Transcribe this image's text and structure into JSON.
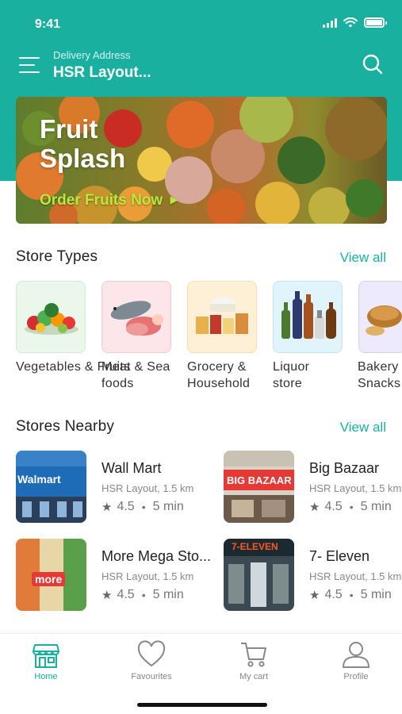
{
  "status_bar": {
    "time": "9:41"
  },
  "header": {
    "address_label": "Delivery Address",
    "address_value": "HSR Layout..."
  },
  "banner": {
    "title": "Fruit Splash",
    "cta": "Order Fruits Now"
  },
  "store_types": {
    "title": "Store Types",
    "view_all": "View all",
    "items": [
      {
        "label": "Vegetables & Fruits",
        "bg": "#eaf7ea"
      },
      {
        "label": "Meat & Sea foods",
        "bg": "#fde6ea"
      },
      {
        "label": "Grocery & Household",
        "bg": "#fdf0d6"
      },
      {
        "label": "Liquor store",
        "bg": "#e2f4fb"
      },
      {
        "label": "Bakery Snacks",
        "bg": "#eceafc"
      }
    ]
  },
  "stores_nearby": {
    "title": "Stores Nearby",
    "view_all": "View all",
    "items": [
      {
        "name": "Wall Mart",
        "meta": "HSR Layout, 1.5 km",
        "rating": "4.5",
        "time": "5 min",
        "logo_text": "Walmart"
      },
      {
        "name": "Big Bazaar",
        "meta": "HSR Layout, 1.5 km",
        "rating": "4.5",
        "time": "5 min",
        "logo_text": "BIG BAZAAR"
      },
      {
        "name": "More Mega Sto...",
        "meta": "HSR Layout, 1.5 km",
        "rating": "4.5",
        "time": "5 min",
        "logo_text": "more"
      },
      {
        "name": "7- Eleven",
        "meta": "HSR Layout, 1.5 km",
        "rating": "4.5",
        "time": "5 min",
        "logo_text": "7-ELEVEN"
      }
    ]
  },
  "bottom_nav": {
    "items": [
      {
        "label": "Home",
        "icon": "store-icon",
        "active": true
      },
      {
        "label": "Favourites",
        "icon": "heart-icon",
        "active": false
      },
      {
        "label": "My cart",
        "icon": "cart-icon",
        "active": false
      },
      {
        "label": "Profile",
        "icon": "user-icon",
        "active": false
      }
    ]
  },
  "colors": {
    "accent": "#19b0a0",
    "cta": "#b6ea3c"
  }
}
